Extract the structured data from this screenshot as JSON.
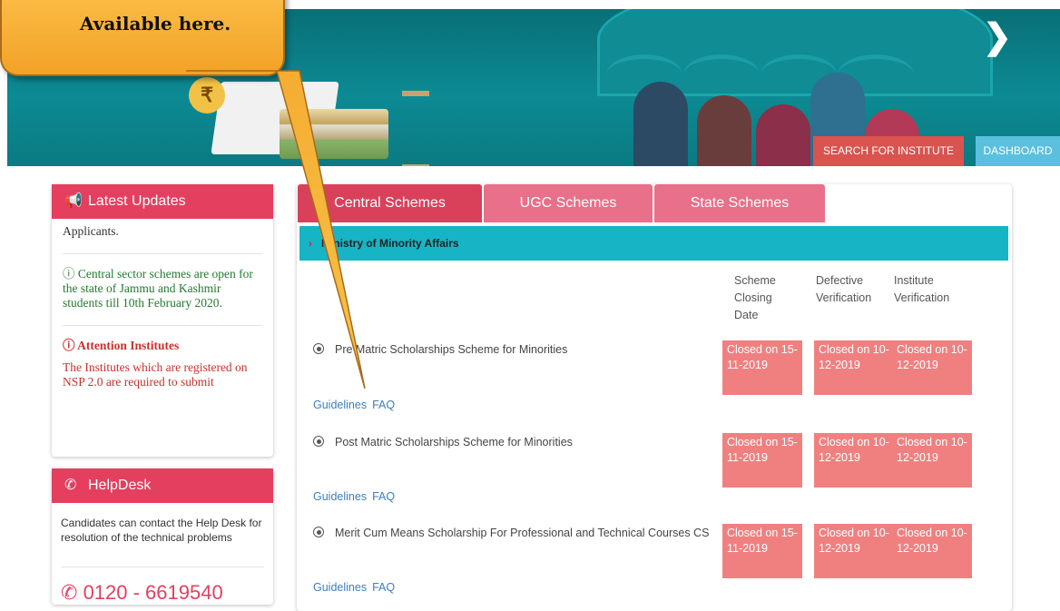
{
  "callout": {
    "line": "Available here."
  },
  "banner": {
    "search_button": "SEARCH FOR INSTITUTE",
    "dashboard_button": "DASHBOARD",
    "rupee": "₹"
  },
  "updates": {
    "title": "Latest Updates",
    "item0": "Applicants.",
    "item1_icon": "ⓘ",
    "item1": "Central sector schemes are open for the state of Jammu and Kashmir students till 10th February 2020.",
    "item2_title": "Attention Institutes",
    "item2": "The Institutes which are registered on NSP 2.0 are required to submit"
  },
  "helpdesk": {
    "title": "HelpDesk",
    "text": "Candidates can contact the Help Desk for resolution of the technical problems",
    "phone": "0120 - 6619540"
  },
  "tabs": [
    "Central Schemes",
    "UGC Schemes",
    "State Schemes"
  ],
  "ministry": "Ministry of Minority Affairs",
  "columns": {
    "closing": "Scheme Closing Date",
    "defective": "Defective Verification",
    "institute": "Institute Verification"
  },
  "schemes": [
    {
      "name": "Pre Matric Scholarships Scheme for Minorities",
      "closing": "Closed on 15-11-2019",
      "defective": "Closed on 10-12-2019",
      "institute": "Closed on 10-12-2019",
      "guidelines": "Guidelines",
      "faq": "FAQ"
    },
    {
      "name": "Post Matric Scholarships Scheme for Minorities",
      "closing": "Closed on 15-11-2019",
      "defective": "Closed on 10-12-2019",
      "institute": "Closed on 10-12-2019",
      "guidelines": "Guidelines",
      "faq": "FAQ"
    },
    {
      "name": "Merit Cum Means Scholarship For Professional and Technical Courses CS",
      "closing": "Closed on 15-11-2019",
      "defective": "Closed on 10-12-2019",
      "institute": "Closed on 10-12-2019",
      "guidelines": "Guidelines",
      "faq": "FAQ"
    }
  ],
  "colors": {
    "accent_red": "#e43f5f",
    "ministry_bar": "#17b4c6",
    "closed_cell": "#f08080",
    "active_tab": "#d9415b",
    "inactive_tab": "#e8708a"
  }
}
